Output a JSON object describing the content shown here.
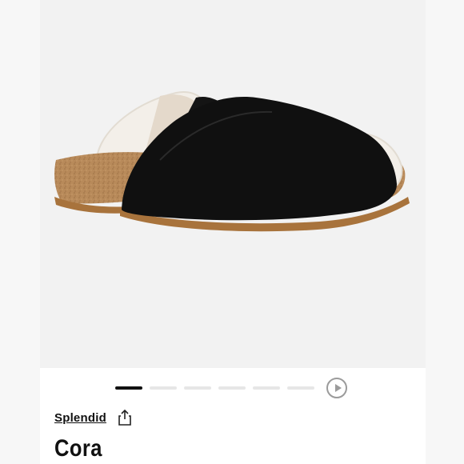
{
  "product": {
    "brand": "Splendid",
    "name": "Cora"
  },
  "gallery": {
    "image_icon": "black-suede-shearling-mule-image",
    "slide_count": 6,
    "active_slide": 1
  },
  "icons": {
    "share": "share-icon",
    "play": "play-icon"
  },
  "colors": {
    "active_dot": "#111111",
    "inactive_dot": "#e6e6e6",
    "play": "#9b9b9b"
  }
}
